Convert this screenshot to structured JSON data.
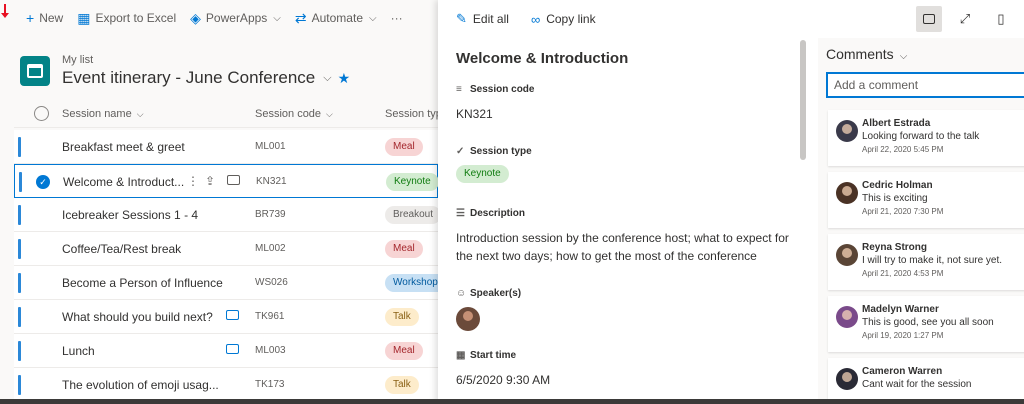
{
  "commandbar": {
    "new_label": "New",
    "export_label": "Export to Excel",
    "powerapps_label": "PowerApps",
    "automate_label": "Automate",
    "more_label": "···"
  },
  "list": {
    "breadcrumb": "My list",
    "title": "Event itinerary - June Conference",
    "columns": {
      "name": "Session name",
      "code": "Session code",
      "type": "Session type"
    },
    "rows": [
      {
        "name": "Breakfast meet & greet",
        "code": "ML001",
        "type": "Meal"
      },
      {
        "name": "Welcome & Introduct...",
        "code": "KN321",
        "type": "Keynote"
      },
      {
        "name": "Icebreaker Sessions 1 - 4",
        "code": "BR739",
        "type": "Breakout"
      },
      {
        "name": "Coffee/Tea/Rest break",
        "code": "ML002",
        "type": "Meal"
      },
      {
        "name": "Become a Person of Influence",
        "code": "WS026",
        "type": "Workshop"
      },
      {
        "name": "What should you build next?",
        "code": "TK961",
        "type": "Talk"
      },
      {
        "name": "Lunch",
        "code": "ML003",
        "type": "Meal"
      },
      {
        "name": "The evolution of emoji usag...",
        "code": "TK173",
        "type": "Talk"
      }
    ]
  },
  "tag_colors": {
    "Meal": {
      "bg": "#f7d4d4",
      "fg": "#a4262c"
    },
    "Keynote": {
      "bg": "#d3ecd1",
      "fg": "#107c10"
    },
    "Breakout": {
      "bg": "#edebe9",
      "fg": "#605e5c"
    },
    "Workshop": {
      "bg": "#c7e0f4",
      "fg": "#005a9e"
    },
    "Talk": {
      "bg": "#fdeccb",
      "fg": "#8a6116"
    }
  },
  "panel": {
    "edit_all_label": "Edit all",
    "copy_link_label": "Copy link",
    "title": "Welcome & Introduction",
    "fields": {
      "session_code_label": "Session code",
      "session_code_value": "KN321",
      "session_type_label": "Session type",
      "session_type_value": "Keynote",
      "description_label": "Description",
      "description_value": "Introduction session by the conference host; what to expect for the next two days; how to get the most of the conference",
      "speakers_label": "Speaker(s)",
      "start_time_label": "Start time",
      "start_time_value": "6/5/2020 9:30 AM"
    }
  },
  "comments": {
    "header": "Comments",
    "input_placeholder": "Add a comment",
    "items": [
      {
        "name": "Albert Estrada",
        "text": "Looking forward to the talk",
        "time": "April 22, 2020 5:45 PM",
        "color": "#3a3a4a"
      },
      {
        "name": "Cedric Holman",
        "text": "This is exciting",
        "time": "April 21, 2020 7:30 PM",
        "color": "#4a3225"
      },
      {
        "name": "Reyna Strong",
        "text": "I will try to make it, not sure yet.",
        "time": "April 21, 2020 4:53 PM",
        "color": "#5a4536"
      },
      {
        "name": "Madelyn Warner",
        "text": "This is good, see you all soon",
        "time": "April 19, 2020 1:27 PM",
        "color": "#7a4a8a"
      },
      {
        "name": "Cameron Warren",
        "text": "Cant wait for the session",
        "time": "",
        "color": "#2a2a35"
      }
    ]
  }
}
